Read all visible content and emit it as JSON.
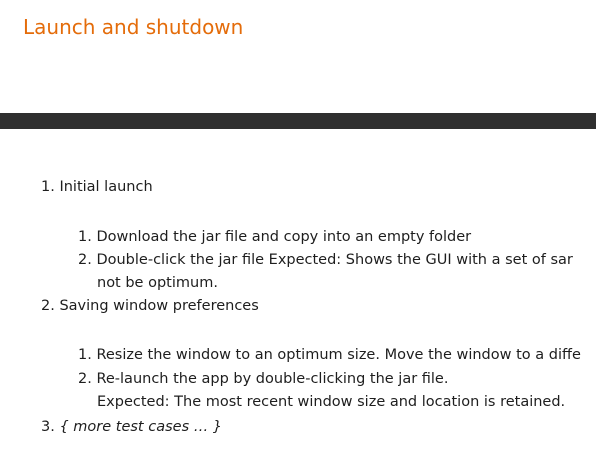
{
  "page": {
    "title": "Launch and shutdown"
  },
  "test_cases": [
    {
      "number": "1.",
      "title": "Initial launch",
      "steps": [
        {
          "number": "1.",
          "lines": [
            "Download the jar file and copy into an empty folder"
          ]
        },
        {
          "number": "2.",
          "lines": [
            "Double-click the jar file Expected: Shows the GUI with a set of sar",
            "not be optimum."
          ]
        }
      ]
    },
    {
      "number": "2.",
      "title": "Saving window preferences",
      "steps": [
        {
          "number": "1.",
          "lines": [
            "Resize the window to an optimum size. Move the window to a diffe"
          ]
        },
        {
          "number": "2.",
          "lines": [
            "Re-launch the app by double-clicking the jar file.",
            "Expected: The most recent window size and location is retained."
          ]
        }
      ]
    },
    {
      "number": "3.",
      "title": "{ more test cases … }"
    }
  ]
}
